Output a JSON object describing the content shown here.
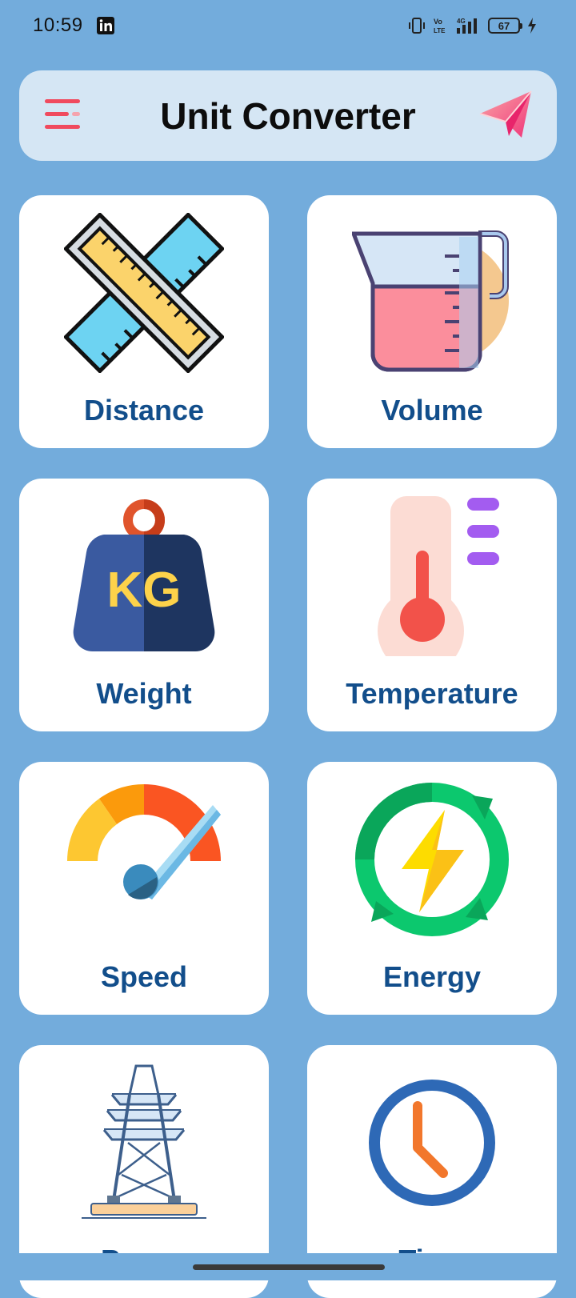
{
  "status_bar": {
    "time": "10:59",
    "battery_level": "67",
    "icons": [
      "linkedin-icon",
      "vibrate-icon",
      "volte-icon",
      "signal-4g-icon",
      "battery-icon",
      "charging-icon"
    ]
  },
  "app_bar": {
    "title": "Unit Converter",
    "menu_icon": "menu-icon",
    "share_icon": "paper-plane-icon"
  },
  "categories": [
    {
      "label": "Distance",
      "icon": "ruler-icon"
    },
    {
      "label": "Volume",
      "icon": "measuring-jug-icon"
    },
    {
      "label": "Weight",
      "icon": "kg-weight-icon"
    },
    {
      "label": "Temperature",
      "icon": "thermometer-icon"
    },
    {
      "label": "Speed",
      "icon": "speedometer-icon"
    },
    {
      "label": "Energy",
      "icon": "energy-icon"
    },
    {
      "label": "Power",
      "icon": "power-tower-icon"
    },
    {
      "label": "Time",
      "icon": "clock-icon"
    }
  ],
  "colors": {
    "background": "#73acdc",
    "app_bar": "#d5e6f4",
    "card": "#ffffff",
    "label": "#124e8b",
    "accent": "#f04a5e"
  }
}
